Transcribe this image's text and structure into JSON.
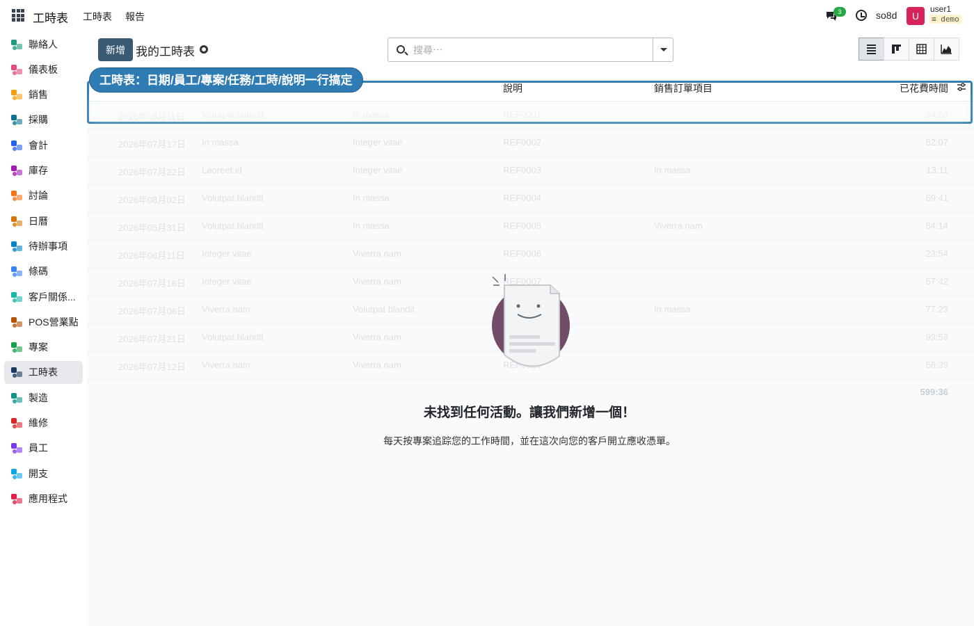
{
  "topbar": {
    "brand": "工時表",
    "menu": [
      "工時表",
      "報告"
    ],
    "chat_badge": "3",
    "company": "so8d",
    "avatar_letter": "U",
    "user_name": "user1",
    "db_name": "demo"
  },
  "sidebar": {
    "items": [
      {
        "label": "聯絡人",
        "icon": "contacts-icon",
        "color": "#1c9c7c"
      },
      {
        "label": "儀表板",
        "icon": "dashboard-icon",
        "color": "#e44d7b"
      },
      {
        "label": "銷售",
        "icon": "sales-icon",
        "color": "#f59e0b"
      },
      {
        "label": "採購",
        "icon": "purchase-icon",
        "color": "#0e7490"
      },
      {
        "label": "會計",
        "icon": "accounting-icon",
        "color": "#2563eb"
      },
      {
        "label": "庫存",
        "icon": "inventory-icon",
        "color": "#a21caf"
      },
      {
        "label": "討論",
        "icon": "discuss-icon",
        "color": "#f97316"
      },
      {
        "label": "日曆",
        "icon": "calendar-icon",
        "color": "#d97706"
      },
      {
        "label": "待辦事項",
        "icon": "todo-icon",
        "color": "#0284c7"
      },
      {
        "label": "條碼",
        "icon": "barcode-icon",
        "color": "#3b82f6"
      },
      {
        "label": "客戶關係...",
        "icon": "crm-icon",
        "color": "#14b8a6"
      },
      {
        "label": "POS營業點",
        "icon": "pos-icon",
        "color": "#b45309"
      },
      {
        "label": "專案",
        "icon": "project-icon",
        "color": "#16a34a"
      },
      {
        "label": "工時表",
        "icon": "timesheet-icon",
        "color": "#1e3a5f",
        "active": true
      },
      {
        "label": "製造",
        "icon": "manufacturing-icon",
        "color": "#0d9488"
      },
      {
        "label": "維修",
        "icon": "repair-icon",
        "color": "#dc2626"
      },
      {
        "label": "員工",
        "icon": "employees-icon",
        "color": "#7c3aed"
      },
      {
        "label": "開支",
        "icon": "expenses-icon",
        "color": "#0ea5e9"
      },
      {
        "label": "應用程式",
        "icon": "apps-icon",
        "color": "#e11d48"
      }
    ]
  },
  "control": {
    "new_label": "新增",
    "title": "我的工時表",
    "search_placeholder": "搜尋⋯"
  },
  "table": {
    "headers": {
      "description": "說明",
      "sale_line": "銷售訂單項目",
      "time_spent": "已花費時間"
    },
    "rows": [
      {
        "date": "2026年08月11日",
        "project": "Volutpat blandit",
        "task": "In massa",
        "desc": "REF0001",
        "sale": "",
        "time": "34:50"
      },
      {
        "date": "2026年07月17日",
        "project": "In massa",
        "task": "Integer vitae",
        "desc": "REF0002",
        "sale": "",
        "time": "82:07"
      },
      {
        "date": "2026年07月22日",
        "project": "Laoreet id",
        "task": "Integer vitae",
        "desc": "REF0003",
        "sale": "In massa",
        "time": "13:11"
      },
      {
        "date": "2026年08月02日",
        "project": "Volutpat blandit",
        "task": "In massa",
        "desc": "REF0004",
        "sale": "",
        "time": "69:41"
      },
      {
        "date": "2026年05月31日",
        "project": "Volutpat blandit",
        "task": "In massa",
        "desc": "REF0005",
        "sale": "Viverra nam",
        "time": "84:14"
      },
      {
        "date": "2026年06月11日",
        "project": "Integer vitae",
        "task": "Viverra nam",
        "desc": "REF0006",
        "sale": "",
        "time": "23:54"
      },
      {
        "date": "2026年07月16日",
        "project": "Integer vitae",
        "task": "Viverra nam",
        "desc": "REF0007",
        "sale": "",
        "time": "57:42"
      },
      {
        "date": "2026年07月06日",
        "project": "Viverra nam",
        "task": "Volutpat blandit",
        "desc": "REF0008",
        "sale": "In massa",
        "time": "77:23"
      },
      {
        "date": "2026年07月21日",
        "project": "Volutpat blandit",
        "task": "Viverra nam",
        "desc": "REF0009",
        "sale": "",
        "time": "99:53"
      },
      {
        "date": "2026年07月12日",
        "project": "Viverra nam",
        "task": "Viverra nam",
        "desc": "REF0010",
        "sale": "",
        "time": "56:39"
      }
    ],
    "total": "599:36"
  },
  "tour": {
    "text": "工時表：日期/員工/專案/任務/工時/說明一行搞定"
  },
  "empty": {
    "title": "未找到任何活動。讓我們新增一個！",
    "subtitle": "每天按專案追踪您的工作時間，並在這次向您的客戶開立應收憑單。"
  }
}
